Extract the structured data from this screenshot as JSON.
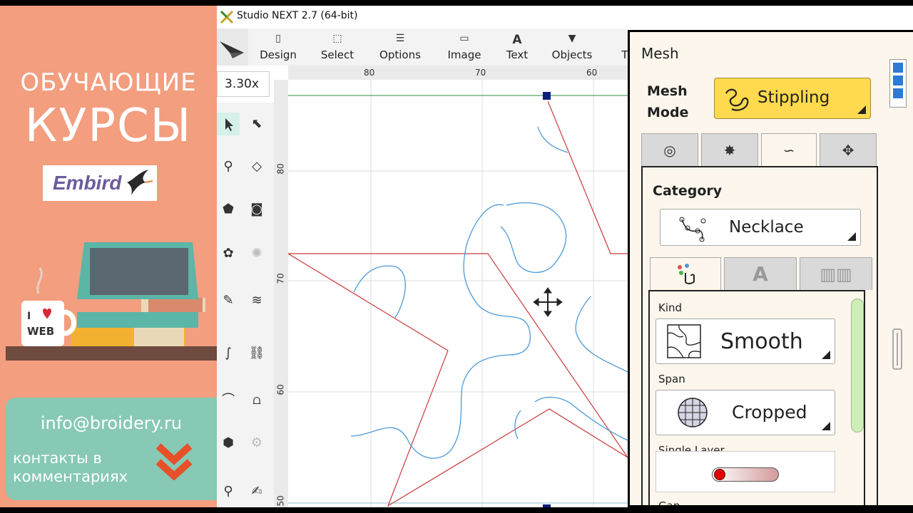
{
  "promo": {
    "line1": "ОБУЧАЮЩИЕ",
    "line2": "КУРСЫ",
    "logo": "Embird",
    "mug_top": "I",
    "mug_bottom": "WEB",
    "email": "info@broidery.ru",
    "contacts_1": "контакты в",
    "contacts_2": "комментариях"
  },
  "app": {
    "title": "Studio NEXT 2.7 (64-bit)",
    "toolbar": [
      {
        "label": "Design",
        "icon": "document-icon"
      },
      {
        "label": "Select",
        "icon": "select-icon"
      },
      {
        "label": "Options",
        "icon": "sliders-icon"
      },
      {
        "label": "Image",
        "icon": "image-icon"
      },
      {
        "label": "Text",
        "icon": "text-icon"
      },
      {
        "label": "Objects",
        "icon": "objects-icon"
      },
      {
        "label": "T",
        "icon": ""
      }
    ],
    "zoom": "3.30x",
    "ruler_h": [
      "80",
      "70",
      "60"
    ],
    "ruler_v": [
      "80",
      "70",
      "60",
      "50"
    ]
  },
  "mesh_panel": {
    "title": "Mesh",
    "mesh_mode_label_1": "Mesh",
    "mesh_mode_label_2": "Mode",
    "mesh_mode_value": "Stippling",
    "category_label": "Category",
    "category_value": "Necklace",
    "tab2_letter": "A",
    "kind_label": "Kind",
    "kind_value": "Smooth",
    "span_label": "Span",
    "span_value": "Cropped",
    "single_layer_label": "Single Layer",
    "gap_label": "Gap",
    "colors": {
      "mode_button": "#FFD94E",
      "toggle_knob": "#E00000",
      "accent_blue": "#2B7BD9"
    }
  }
}
